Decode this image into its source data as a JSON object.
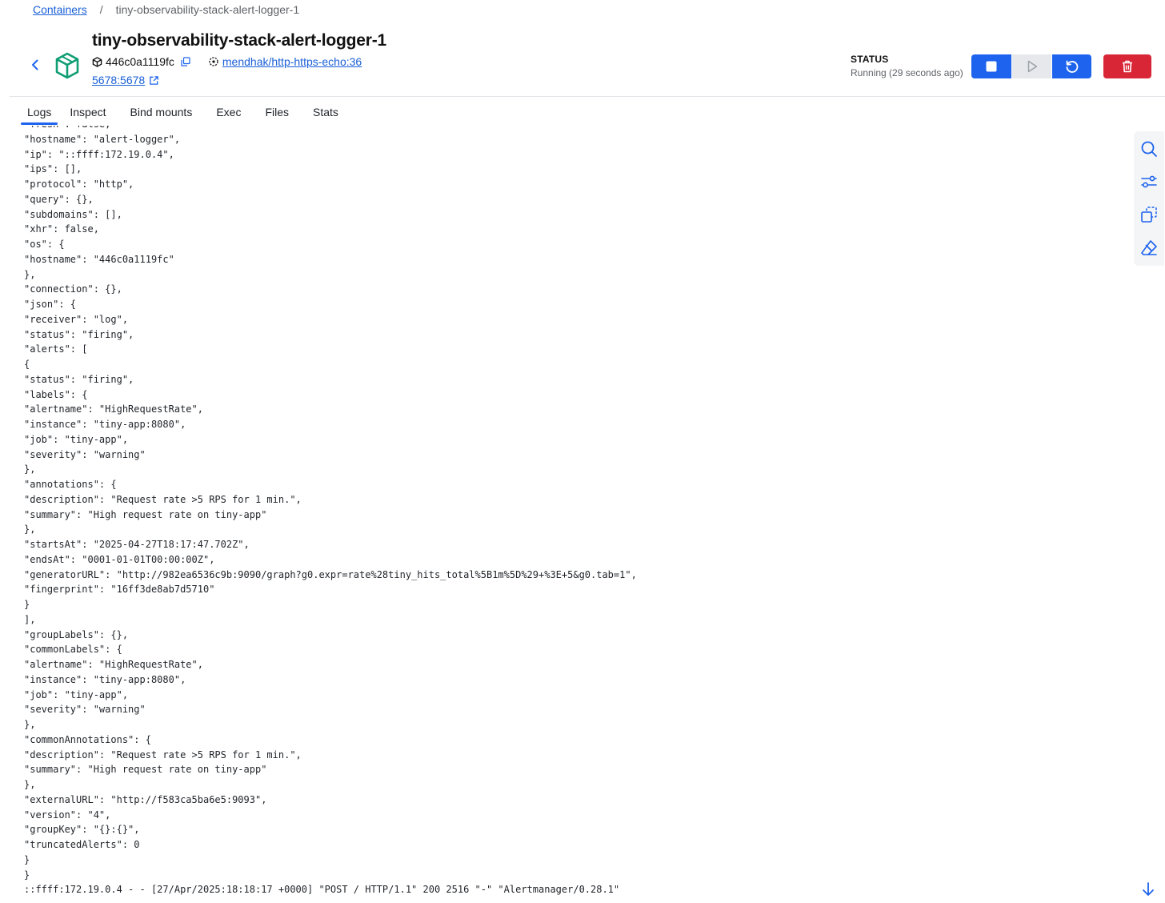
{
  "breadcrumb": {
    "root": "Containers",
    "separator": "/",
    "current": "tiny-observability-stack-alert-logger-1"
  },
  "container": {
    "name": "tiny-observability-stack-alert-logger-1",
    "id": "446c0a1119fc",
    "image": "mendhak/http-https-echo:36",
    "port": "5678:5678"
  },
  "status": {
    "label": "STATUS",
    "text": "Running (29 seconds ago)"
  },
  "tabs": [
    {
      "label": "Logs",
      "active": true
    },
    {
      "label": "Inspect",
      "active": false
    },
    {
      "label": "Bind mounts",
      "active": false
    },
    {
      "label": "Exec",
      "active": false
    },
    {
      "label": "Files",
      "active": false
    },
    {
      "label": "Stats",
      "active": false
    }
  ],
  "logs": [
    "\"fresh\": false,",
    "\"hostname\": \"alert-logger\",",
    "\"ip\": \"::ffff:172.19.0.4\",",
    "\"ips\": [],",
    "\"protocol\": \"http\",",
    "\"query\": {},",
    "\"subdomains\": [],",
    "\"xhr\": false,",
    "\"os\": {",
    "\"hostname\": \"446c0a1119fc\"",
    "},",
    "\"connection\": {},",
    "\"json\": {",
    "\"receiver\": \"log\",",
    "\"status\": \"firing\",",
    "\"alerts\": [",
    "{",
    "\"status\": \"firing\",",
    "\"labels\": {",
    "\"alertname\": \"HighRequestRate\",",
    "\"instance\": \"tiny-app:8080\",",
    "\"job\": \"tiny-app\",",
    "\"severity\": \"warning\"",
    "},",
    "\"annotations\": {",
    "\"description\": \"Request rate >5 RPS for 1 min.\",",
    "\"summary\": \"High request rate on tiny-app\"",
    "},",
    "\"startsAt\": \"2025-04-27T18:17:47.702Z\",",
    "\"endsAt\": \"0001-01-01T00:00:00Z\",",
    "\"generatorURL\": \"http://982ea6536c9b:9090/graph?g0.expr=rate%28tiny_hits_total%5B1m%5D%29+%3E+5&g0.tab=1\",",
    "\"fingerprint\": \"16ff3de8ab7d5710\"",
    "}",
    "],",
    "\"groupLabels\": {},",
    "\"commonLabels\": {",
    "\"alertname\": \"HighRequestRate\",",
    "\"instance\": \"tiny-app:8080\",",
    "\"job\": \"tiny-app\",",
    "\"severity\": \"warning\"",
    "},",
    "\"commonAnnotations\": {",
    "\"description\": \"Request rate >5 RPS for 1 min.\",",
    "\"summary\": \"High request rate on tiny-app\"",
    "},",
    "\"externalURL\": \"http://f583ca5ba6e5:9093\",",
    "\"version\": \"4\",",
    "\"groupKey\": \"{}:{}\",",
    "\"truncatedAlerts\": 0",
    "}",
    "}",
    "::ffff:172.19.0.4 - - [27/Apr/2025:18:18:17 +0000] \"POST / HTTP/1.1\" 200 2516 \"-\" \"Alertmanager/0.28.1\""
  ],
  "icons": {
    "back": "chevron-left-icon",
    "container": "container-cube-icon",
    "id": "cube-small-icon",
    "copy": "copy-icon",
    "image": "image-icon",
    "external": "external-link-icon",
    "stop": "stop-icon",
    "start": "play-icon",
    "restart": "restart-icon",
    "delete": "trash-icon",
    "search": "search-icon",
    "filter": "filter-icon",
    "copy_logs": "copy-logs-icon",
    "clear": "eraser-icon",
    "scroll": "arrow-down-icon"
  },
  "colors": {
    "primary": "#1d63ed",
    "danger": "#d92636",
    "container_icon": "#0f9d74",
    "link": "#1a5fd6"
  }
}
